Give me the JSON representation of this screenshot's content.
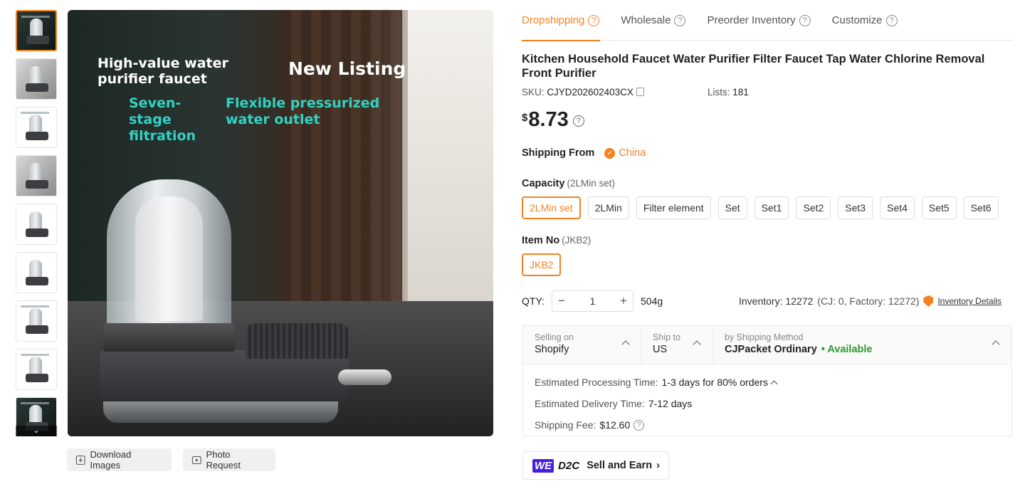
{
  "tabs": [
    {
      "label": "Dropshipping",
      "active": true
    },
    {
      "label": "Wholesale",
      "active": false
    },
    {
      "label": "Preorder Inventory",
      "active": false
    },
    {
      "label": "Customize",
      "active": false
    }
  ],
  "product": {
    "title": "Kitchen Household Faucet Water Purifier Filter Faucet Tap Water Chlorine Removal Front Purifier",
    "sku_label": "SKU:",
    "sku": "CJYD202602403CX",
    "lists_label": "Lists:",
    "lists": "181",
    "currency": "$",
    "price": "8.73"
  },
  "image_overlay": {
    "title": "High-value water purifier faucet",
    "badge": "New Listing",
    "feature1": "Seven-stage filtration",
    "feature2": "Flexible pressurized water outlet"
  },
  "image_buttons": {
    "download": "Download Images",
    "photo_request": "Photo Request"
  },
  "shipping_from": {
    "label": "Shipping From",
    "country": "China"
  },
  "capacity": {
    "label": "Capacity",
    "selected": "(2LMin set)",
    "options": [
      "2LMin set",
      "2LMin",
      "Filter element",
      "Set",
      "Set1",
      "Set2",
      "Set3",
      "Set4",
      "Set5",
      "Set6"
    ]
  },
  "item_no": {
    "label": "Item No",
    "selected": "(JKB2)",
    "options": [
      "JKB2"
    ]
  },
  "qty": {
    "label": "QTY:",
    "value": "1",
    "minus": "−",
    "plus": "+",
    "weight": "504g"
  },
  "inventory": {
    "label": "Inventory: 12272",
    "detail": "(CJ: 0, Factory: 12272)",
    "link": "Inventory Details"
  },
  "shipping_panel": {
    "selling_on_label": "Selling on",
    "selling_on": "Shopify",
    "ship_to_label": "Ship to",
    "ship_to": "US",
    "method_label": "by Shipping Method",
    "method": "CJPacket Ordinary",
    "availability": "• Available",
    "processing_label": "Estimated Processing Time:",
    "processing": "1-3 days for 80% orders",
    "delivery_label": "Estimated Delivery Time:",
    "delivery": "7-12 days",
    "fee_label": "Shipping Fee:",
    "fee": "$12.60"
  },
  "d2c": {
    "we": "WE",
    "d2c": "D2C",
    "label": "Sell and Earn",
    "arrow": "›"
  },
  "colors": {
    "accent": "#f5811f",
    "available": "#2c9a2c",
    "we_badge": "#4a1ee0"
  }
}
